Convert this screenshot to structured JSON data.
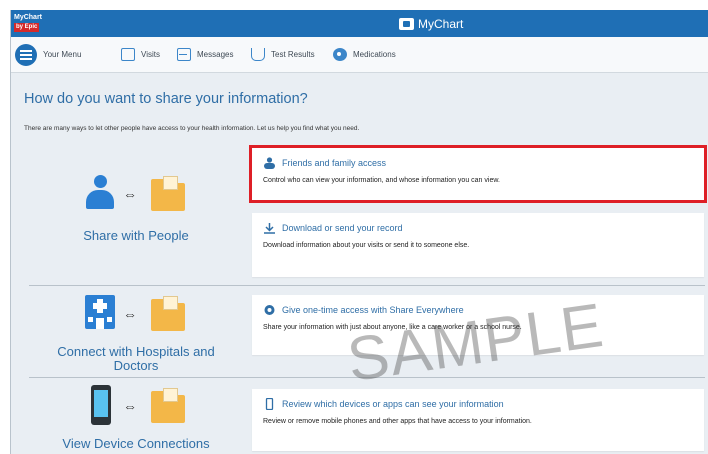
{
  "header": {
    "corner_logo_line1": "MyChart",
    "corner_logo_line2": "by Epic",
    "brand": "MyChart"
  },
  "nav": {
    "items": [
      {
        "label": "Your Menu",
        "icon": "menu-icon"
      },
      {
        "label": "Visits",
        "icon": "calendar-icon"
      },
      {
        "label": "Messages",
        "icon": "envelope-icon"
      },
      {
        "label": "Test Results",
        "icon": "flask-icon"
      },
      {
        "label": "Medications",
        "icon": "pill-icon"
      }
    ]
  },
  "page": {
    "title": "How do you want to share your information?",
    "intro": "There are many ways to let other people have access to your health information. Let us help you find what you need."
  },
  "options": [
    {
      "label": "Share with People",
      "icon": "person-icon"
    },
    {
      "label": "Connect with Hospitals and Doctors",
      "icon": "hospital-icon"
    },
    {
      "label": "View Device Connections",
      "icon": "phone-icon"
    }
  ],
  "cards": [
    {
      "title": "Friends and family access",
      "desc": "Control who can view your information, and whose information you can view.",
      "icon": "family-icon",
      "highlighted": true
    },
    {
      "title": "Download or send your record",
      "desc": "Download information about your visits or send it to someone else.",
      "icon": "download-icon",
      "highlighted": false
    },
    {
      "title": "Give one-time access with Share Everywhere",
      "desc": "Share your information with just about anyone, like a care worker or a school nurse.",
      "icon": "share-icon",
      "highlighted": false
    },
    {
      "title": "Review which devices or apps can see your information",
      "desc": "Review or remove mobile phones and other apps that have access to your information.",
      "icon": "device-icon",
      "highlighted": false
    }
  ],
  "watermark": "SAMPLE",
  "colors": {
    "header_blue": "#1f6fb5",
    "link_blue": "#2f6ea6",
    "highlight_red": "#de1f26",
    "folder_yellow": "#f3b748"
  }
}
